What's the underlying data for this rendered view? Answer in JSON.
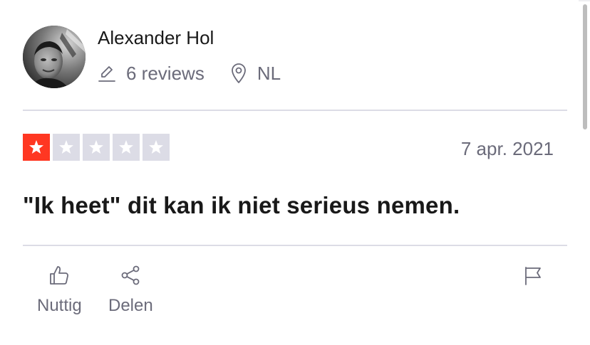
{
  "reviewer": {
    "name": "Alexander Hol",
    "reviews_count": "6 reviews",
    "country": "NL",
    "icons": {
      "reviews": "pencil-icon",
      "location": "location-pin-icon"
    }
  },
  "review": {
    "rating": 1,
    "max_rating": 5,
    "date": "7 apr. 2021",
    "title": "\"Ik heet\" dit kan ik niet serieus nemen."
  },
  "actions": {
    "useful_label": "Nuttig",
    "share_label": "Delen"
  },
  "colors": {
    "star_filled": "#ff3722",
    "star_empty": "#dcdce6",
    "muted_text": "#6b6b7a",
    "divider": "#dcdce6"
  }
}
